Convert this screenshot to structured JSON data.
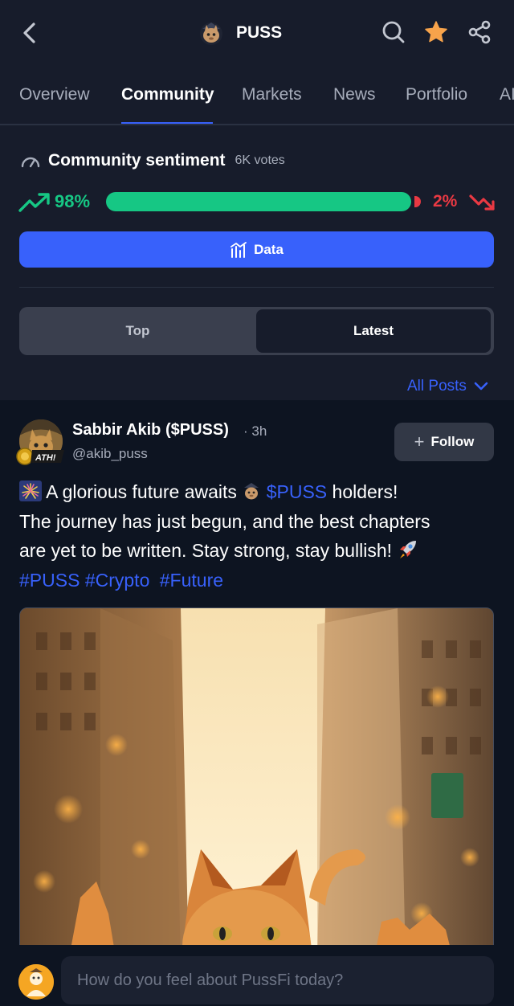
{
  "header": {
    "title": "PUSS",
    "icons": [
      "back-icon",
      "coin-logo",
      "search-icon",
      "star-icon",
      "share-icon"
    ],
    "star_color": "#f7a34b"
  },
  "tabs": [
    {
      "label": "Overview",
      "active": false
    },
    {
      "label": "Community",
      "active": true
    },
    {
      "label": "Markets",
      "active": false
    },
    {
      "label": "News",
      "active": false
    },
    {
      "label": "Portfolio",
      "active": false
    },
    {
      "label": "AI",
      "active": false
    }
  ],
  "sentiment": {
    "title": "Community sentiment",
    "votes": "6K votes",
    "bullish": "98%",
    "bearish": "2%",
    "bullish_fraction": 0.98,
    "bullish_color": "#16c784",
    "bearish_color": "#ea3943"
  },
  "data_button": "Data",
  "segment": {
    "top": "Top",
    "latest": "Latest",
    "selected": "Latest"
  },
  "filter": {
    "label": "All Posts"
  },
  "post": {
    "author": "Sabbir Akib ($PUSS)",
    "time": "· 3h",
    "handle": "@akib_puss",
    "badge": "ATH!",
    "follow_label": "Follow",
    "text": {
      "l1_a": "A glorious future awaits",
      "l1_cashtag": "$PUSS",
      "l1_b": "holders!",
      "line2": "The journey has just begun, and the best chapters",
      "line3": "are yet to be written. Stay strong, stay bullish!",
      "hashtags": [
        "#PUSS",
        "#Crypto",
        "#Future"
      ]
    }
  },
  "composer": {
    "placeholder": "How do you feel about PussFi today?"
  },
  "colors": {
    "accent": "#3861fb",
    "background": "#0d1421",
    "surface": "#171c2b"
  }
}
